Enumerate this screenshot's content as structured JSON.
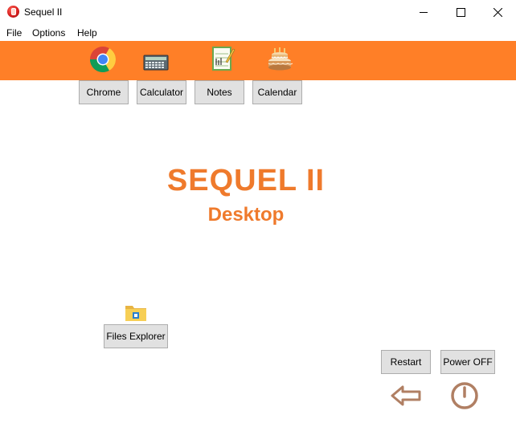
{
  "window": {
    "title": "Sequel II"
  },
  "menu": {
    "file": "File",
    "options": "Options",
    "help": "Help"
  },
  "toolbar": {
    "apps": [
      {
        "label": "Chrome",
        "icon": "chrome-icon"
      },
      {
        "label": "Calculator",
        "icon": "calculator-icon"
      },
      {
        "label": "Notes",
        "icon": "notes-icon"
      },
      {
        "label": "Calendar",
        "icon": "calendar-cake-icon"
      }
    ]
  },
  "hero": {
    "title": "SEQUEL II",
    "subtitle": "Desktop"
  },
  "desktop": {
    "files_explorer": {
      "label": "Files Explorer",
      "icon": "folder-icon"
    }
  },
  "system": {
    "restart": "Restart",
    "power_off": "Power OFF",
    "back_icon": "back-arrow-icon",
    "power_icon": "power-icon"
  },
  "colors": {
    "toolbar_bg": "#ff7f27",
    "accent_text": "#ef7a2c",
    "button_bg": "#e1e1e1",
    "icon_brown": "#b07f63"
  }
}
